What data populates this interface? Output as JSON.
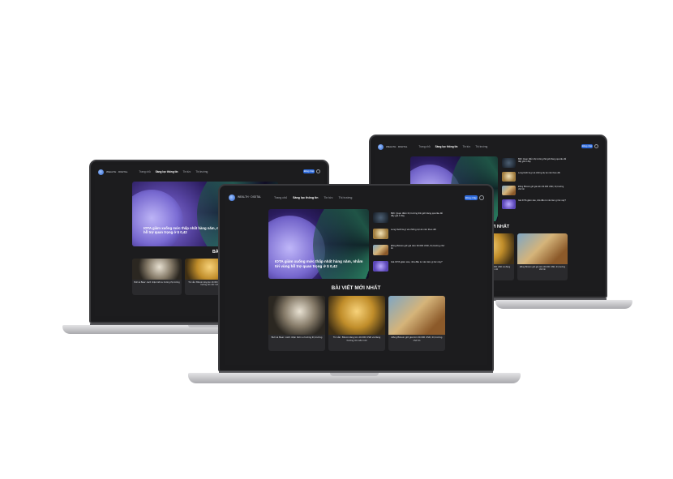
{
  "site": {
    "brand_line1": "WEALTH · DIGITAL",
    "brand_line2": "· · · · · ·",
    "nav": [
      "Trang chủ",
      "Sàng lọc thông tin",
      "Tin tức",
      "Thị trường"
    ],
    "nav_button": "Đăng nhập",
    "section_title": "BÀI VIẾT MỚI NHẤT"
  },
  "hero": {
    "caption": "IOTA giảm xuống mức thấp nhất hàng năm, nhắm tới vùng hỗ trợ quan trọng ở $ 0,42"
  },
  "sidebar": [
    {
      "text": "Bitfi: Quan điểm thị trường thế giới đang quá lâu để đẩy giá ở đáy",
      "thumb": "dark"
    },
    {
      "text": "Long DeFi là gì và những dự án nên theo dõi",
      "thumb": "coin"
    },
    {
      "text": "Đồng Bitcoin giữ giá trên 30.000 USD, thị trường chờ tin",
      "thumb": "mix"
    },
    {
      "text": "Giá IOTA giảm sâu, nhà đầu tư nên làm gì lúc này?",
      "thumb": "purple"
    }
  ],
  "cards": [
    {
      "text": "Bull và Bear: cách nhận biết xu hướng thị trường",
      "thumb": "bull"
    },
    {
      "text": "Tin vắn: Bitcoin tăng lên 40.000 USD và đang hướng tới mốc mới",
      "thumb": "gold"
    },
    {
      "text": "Đồng Bitcoin giữ giá trên 30.000 USD, thị trường chờ tin",
      "thumb": "mix"
    }
  ]
}
